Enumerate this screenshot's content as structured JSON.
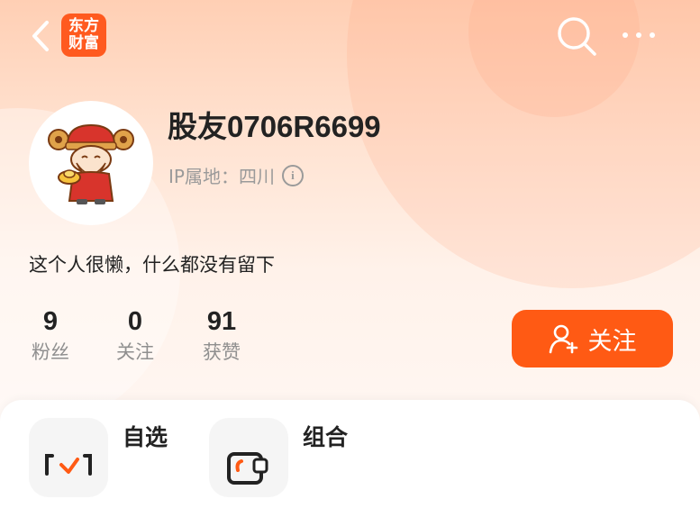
{
  "header": {
    "logo_line1": "东方",
    "logo_line2": "财富",
    "icons": [
      "back-arrow-icon",
      "search-icon",
      "more-icon"
    ]
  },
  "profile": {
    "username": "股友0706R6699",
    "ip_label": "IP属地：四川",
    "bio": "这个人很懒，什么都没有留下"
  },
  "stats": [
    {
      "value": "9",
      "label": "粉丝"
    },
    {
      "value": "0",
      "label": "关注"
    },
    {
      "value": "91",
      "label": "获赞"
    }
  ],
  "follow_button": {
    "label": "关注"
  },
  "sections": [
    {
      "label": "自选"
    },
    {
      "label": "组合"
    }
  ],
  "colors": {
    "accent": "#ff5a14",
    "logo": "#ff5a1f"
  }
}
